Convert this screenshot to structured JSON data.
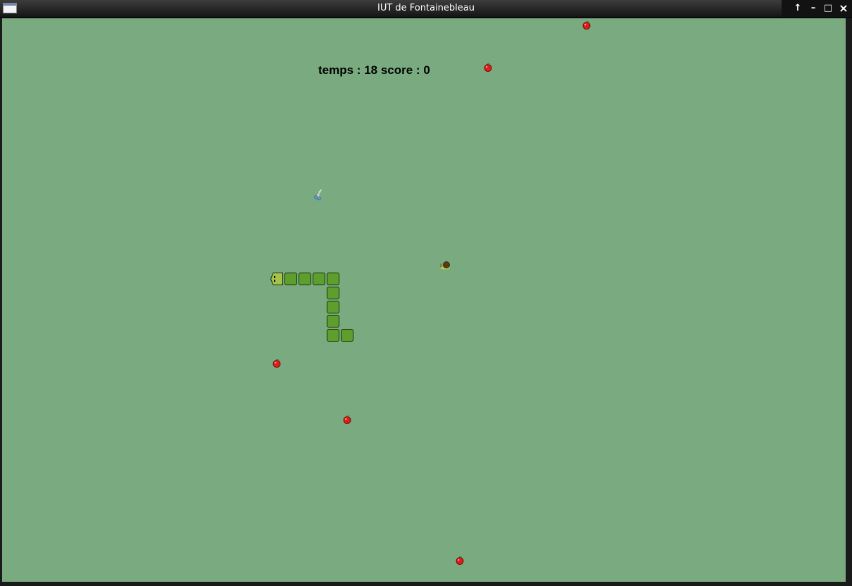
{
  "window": {
    "title": "IUT de Fontainebleau",
    "controls": [
      "↑",
      "–",
      "□",
      "×"
    ]
  },
  "hud": {
    "temps_label": "temps : ",
    "temps_value": "18",
    "score_label": " score : ",
    "score_value": "0"
  },
  "colors": {
    "background": "#7aab80",
    "snake_body": "#5e9e2c",
    "apple": "#e01b1b"
  },
  "grid": {
    "columns": 60,
    "rows": 40
  },
  "snake": {
    "head": [
      19,
      18
    ],
    "body": [
      [
        20,
        18
      ],
      [
        21,
        18
      ],
      [
        22,
        18
      ],
      [
        23,
        18
      ],
      [
        23,
        19
      ],
      [
        23,
        20
      ],
      [
        23,
        21
      ],
      [
        23,
        22
      ],
      [
        24,
        22
      ]
    ]
  },
  "apples": [
    [
      41,
      0
    ],
    [
      34,
      3
    ],
    [
      19,
      24
    ],
    [
      24,
      28
    ],
    [
      32,
      38
    ]
  ],
  "items": [
    {
      "icon": "scissors-icon",
      "cell": [
        22,
        12
      ]
    },
    {
      "icon": "snail-icon",
      "cell": [
        31,
        17
      ]
    }
  ]
}
